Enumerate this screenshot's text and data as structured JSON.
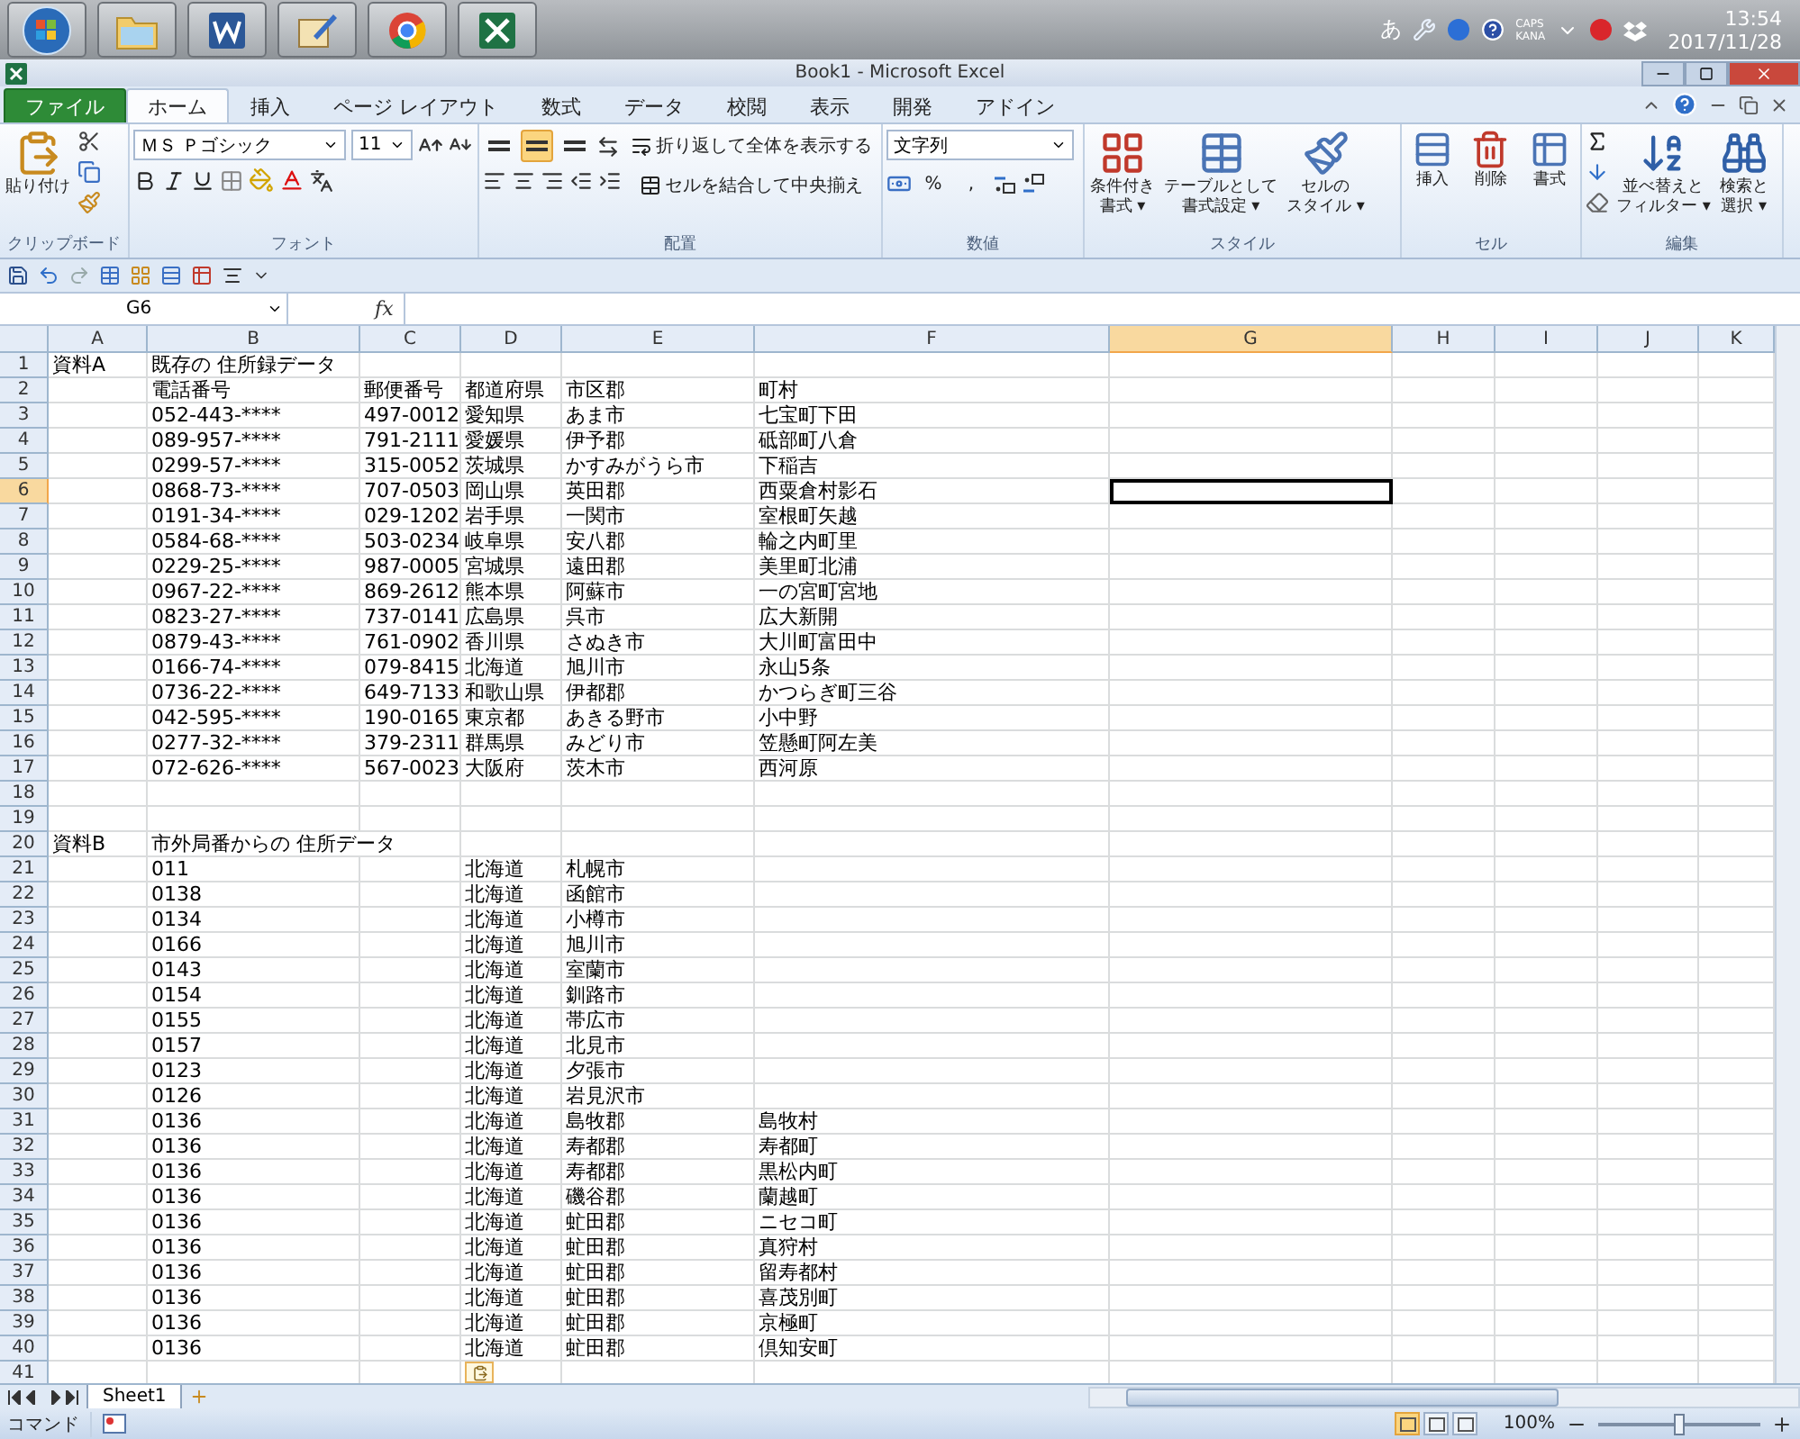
{
  "taskbar": {
    "apps": [
      {
        "kind": "start"
      },
      {
        "kind": "folder"
      },
      {
        "kind": "word"
      },
      {
        "kind": "notepad"
      },
      {
        "kind": "chrome"
      },
      {
        "kind": "excel"
      }
    ],
    "ime": "あ",
    "caps": "CAPS",
    "kana": "KANA",
    "time": "13:54",
    "date": "2017/11/28"
  },
  "window": {
    "title": "Book1 - Microsoft Excel"
  },
  "ribbon_tabs": [
    {
      "label": "ファイル",
      "kind": "file",
      "selected": false
    },
    {
      "label": "ホーム",
      "kind": "tab",
      "selected": true
    },
    {
      "label": "挿入",
      "kind": "tab",
      "selected": false
    },
    {
      "label": "ページ レイアウト",
      "kind": "tab",
      "selected": false
    },
    {
      "label": "数式",
      "kind": "tab",
      "selected": false
    },
    {
      "label": "データ",
      "kind": "tab",
      "selected": false
    },
    {
      "label": "校閲",
      "kind": "tab",
      "selected": false
    },
    {
      "label": "表示",
      "kind": "tab",
      "selected": false
    },
    {
      "label": "開発",
      "kind": "tab",
      "selected": false
    },
    {
      "label": "アドイン",
      "kind": "tab",
      "selected": false
    }
  ],
  "ribbon": {
    "clipboard": {
      "paste": "貼り付け",
      "label": "クリップボード"
    },
    "font": {
      "name": "ＭＳ Ｐゴシック",
      "size": "11",
      "label": "フォント"
    },
    "alignment": {
      "vertical": [
        {
          "selected": false
        },
        {
          "selected": true
        },
        {
          "selected": false
        }
      ],
      "wrap": "折り返して全体を表示する",
      "merge": "セルを結合して中央揃え",
      "label": "配置"
    },
    "number": {
      "format": "文字列",
      "percent": "%",
      "comma": ",",
      "label": "数値"
    },
    "styles": {
      "buttons": [
        {
          "lines": [
            "条件付き",
            "書式 ▾"
          ],
          "kind": "conditional"
        },
        {
          "lines": [
            "テーブルとして",
            "書式設定 ▾"
          ],
          "kind": "table"
        },
        {
          "lines": [
            "セルの",
            "スタイル ▾"
          ],
          "kind": "cellstyle"
        }
      ],
      "label": "スタイル"
    },
    "cells": {
      "buttons": [
        {
          "label": "挿入",
          "kind": "insert"
        },
        {
          "label": "削除",
          "kind": "delete"
        },
        {
          "label": "書式",
          "kind": "format"
        }
      ],
      "label": "セル"
    },
    "editing": {
      "buttons": [
        {
          "lines": [
            "並べ替えと",
            "フィルター ▾"
          ],
          "kind": "sort"
        },
        {
          "lines": [
            "検索と",
            "選択 ▾"
          ],
          "kind": "find"
        }
      ],
      "label": "編集"
    }
  },
  "formula_bar": {
    "name_box": "G6",
    "fx": "fx"
  },
  "columns": [
    {
      "label": "A",
      "selected": false
    },
    {
      "label": "B",
      "selected": false
    },
    {
      "label": "C",
      "selected": false
    },
    {
      "label": "D",
      "selected": false
    },
    {
      "label": "E",
      "selected": false
    },
    {
      "label": "F",
      "selected": false
    },
    {
      "label": "G",
      "selected": true
    },
    {
      "label": "H",
      "selected": false
    },
    {
      "label": "I",
      "selected": false
    },
    {
      "label": "J",
      "selected": false
    },
    {
      "label": "K",
      "selected": false
    }
  ],
  "rows": [
    {
      "num": "1",
      "selected": false,
      "cells": {
        "a": "資料A",
        "b": "既存の 住所録データ"
      }
    },
    {
      "num": "2",
      "selected": false,
      "cells": {
        "b": "電話番号",
        "c": "郵便番号",
        "d": "都道府県",
        "e": "市区郡",
        "f": "町村"
      }
    },
    {
      "num": "3",
      "selected": false,
      "cells": {
        "b": "052-443-****",
        "c": "497-0012",
        "d": "愛知県",
        "e": "あま市",
        "f": "七宝町下田"
      }
    },
    {
      "num": "4",
      "selected": false,
      "cells": {
        "b": "089-957-****",
        "c": "791-2111",
        "d": "愛媛県",
        "e": "伊予郡",
        "f": "砥部町八倉"
      }
    },
    {
      "num": "5",
      "selected": false,
      "cells": {
        "b": "0299-57-****",
        "c": "315-0052",
        "d": "茨城県",
        "e": "かすみがうら市",
        "f": "下稲吉"
      }
    },
    {
      "num": "6",
      "selected": true,
      "cells": {
        "b": "0868-73-****",
        "c": "707-0503",
        "d": "岡山県",
        "e": "英田郡",
        "f": "西粟倉村影石"
      }
    },
    {
      "num": "7",
      "selected": false,
      "cells": {
        "b": "0191-34-****",
        "c": "029-1202",
        "d": "岩手県",
        "e": "一関市",
        "f": "室根町矢越"
      }
    },
    {
      "num": "8",
      "selected": false,
      "cells": {
        "b": "0584-68-****",
        "c": "503-0234",
        "d": "岐阜県",
        "e": "安八郡",
        "f": "輪之内町里"
      }
    },
    {
      "num": "9",
      "selected": false,
      "cells": {
        "b": "0229-25-****",
        "c": "987-0005",
        "d": "宮城県",
        "e": "遠田郡",
        "f": "美里町北浦"
      }
    },
    {
      "num": "10",
      "selected": false,
      "cells": {
        "b": "0967-22-****",
        "c": "869-2612",
        "d": "熊本県",
        "e": "阿蘇市",
        "f": "一の宮町宮地"
      }
    },
    {
      "num": "11",
      "selected": false,
      "cells": {
        "b": "0823-27-****",
        "c": "737-0141",
        "d": "広島県",
        "e": "呉市",
        "f": "広大新開"
      }
    },
    {
      "num": "12",
      "selected": false,
      "cells": {
        "b": "0879-43-****",
        "c": "761-0902",
        "d": "香川県",
        "e": "さぬき市",
        "f": "大川町富田中"
      }
    },
    {
      "num": "13",
      "selected": false,
      "cells": {
        "b": "0166-74-****",
        "c": "079-8415",
        "d": "北海道",
        "e": "旭川市",
        "f": "永山5条"
      }
    },
    {
      "num": "14",
      "selected": false,
      "cells": {
        "b": "0736-22-****",
        "c": "649-7133",
        "d": "和歌山県",
        "e": "伊都郡",
        "f": "かつらぎ町三谷"
      }
    },
    {
      "num": "15",
      "selected": false,
      "cells": {
        "b": "042-595-****",
        "c": "190-0165",
        "d": "東京都",
        "e": "あきる野市",
        "f": "小中野"
      }
    },
    {
      "num": "16",
      "selected": false,
      "cells": {
        "b": "0277-32-****",
        "c": "379-2311",
        "d": "群馬県",
        "e": "みどり市",
        "f": "笠懸町阿左美"
      }
    },
    {
      "num": "17",
      "selected": false,
      "cells": {
        "b": "072-626-****",
        "c": "567-0023",
        "d": "大阪府",
        "e": "茨木市",
        "f": "西河原"
      }
    },
    {
      "num": "18",
      "selected": false,
      "cells": {}
    },
    {
      "num": "19",
      "selected": false,
      "cells": {}
    },
    {
      "num": "20",
      "selected": false,
      "cells": {
        "a": "資料B",
        "b": "市外局番からの 住所データ"
      }
    },
    {
      "num": "21",
      "selected": false,
      "cells": {
        "b": "011",
        "d": "北海道",
        "e": "札幌市"
      }
    },
    {
      "num": "22",
      "selected": false,
      "cells": {
        "b": "0138",
        "d": "北海道",
        "e": "函館市"
      }
    },
    {
      "num": "23",
      "selected": false,
      "cells": {
        "b": "0134",
        "d": "北海道",
        "e": "小樽市"
      }
    },
    {
      "num": "24",
      "selected": false,
      "cells": {
        "b": "0166",
        "d": "北海道",
        "e": "旭川市"
      }
    },
    {
      "num": "25",
      "selected": false,
      "cells": {
        "b": "0143",
        "d": "北海道",
        "e": "室蘭市"
      }
    },
    {
      "num": "26",
      "selected": false,
      "cells": {
        "b": "0154",
        "d": "北海道",
        "e": "釧路市"
      }
    },
    {
      "num": "27",
      "selected": false,
      "cells": {
        "b": "0155",
        "d": "北海道",
        "e": "帯広市"
      }
    },
    {
      "num": "28",
      "selected": false,
      "cells": {
        "b": "0157",
        "d": "北海道",
        "e": "北見市"
      }
    },
    {
      "num": "29",
      "selected": false,
      "cells": {
        "b": "0123",
        "d": "北海道",
        "e": "夕張市"
      }
    },
    {
      "num": "30",
      "selected": false,
      "cells": {
        "b": "0126",
        "d": "北海道",
        "e": "岩見沢市"
      }
    },
    {
      "num": "31",
      "selected": false,
      "cells": {
        "b": "0136",
        "d": "北海道",
        "e": "島牧郡",
        "f": "島牧村"
      }
    },
    {
      "num": "32",
      "selected": false,
      "cells": {
        "b": "0136",
        "d": "北海道",
        "e": "寿都郡",
        "f": "寿都町"
      }
    },
    {
      "num": "33",
      "selected": false,
      "cells": {
        "b": "0136",
        "d": "北海道",
        "e": "寿都郡",
        "f": "黒松内町"
      }
    },
    {
      "num": "34",
      "selected": false,
      "cells": {
        "b": "0136",
        "d": "北海道",
        "e": "磯谷郡",
        "f": "蘭越町"
      }
    },
    {
      "num": "35",
      "selected": false,
      "cells": {
        "b": "0136",
        "d": "北海道",
        "e": "虻田郡",
        "f": "ニセコ町"
      }
    },
    {
      "num": "36",
      "selected": false,
      "cells": {
        "b": "0136",
        "d": "北海道",
        "e": "虻田郡",
        "f": "真狩村"
      }
    },
    {
      "num": "37",
      "selected": false,
      "cells": {
        "b": "0136",
        "d": "北海道",
        "e": "虻田郡",
        "f": "留寿都村"
      }
    },
    {
      "num": "38",
      "selected": false,
      "cells": {
        "b": "0136",
        "d": "北海道",
        "e": "虻田郡",
        "f": "喜茂別町"
      }
    },
    {
      "num": "39",
      "selected": false,
      "cells": {
        "b": "0136",
        "d": "北海道",
        "e": "虻田郡",
        "f": "京極町"
      }
    },
    {
      "num": "40",
      "selected": false,
      "cells": {
        "b": "0136",
        "d": "北海道",
        "e": "虻田郡",
        "f": "倶知安町"
      }
    },
    {
      "num": "41",
      "selected": false,
      "cells": {}
    }
  ],
  "sheet_tabs": [
    {
      "label": "Sheet1",
      "selected": true
    }
  ],
  "status_bar": {
    "mode": "コマンド",
    "views": [
      {
        "selected": true
      },
      {
        "selected": false
      },
      {
        "selected": false
      }
    ],
    "zoom": "100%",
    "zoom_level": {
      "level": 0.5
    }
  }
}
